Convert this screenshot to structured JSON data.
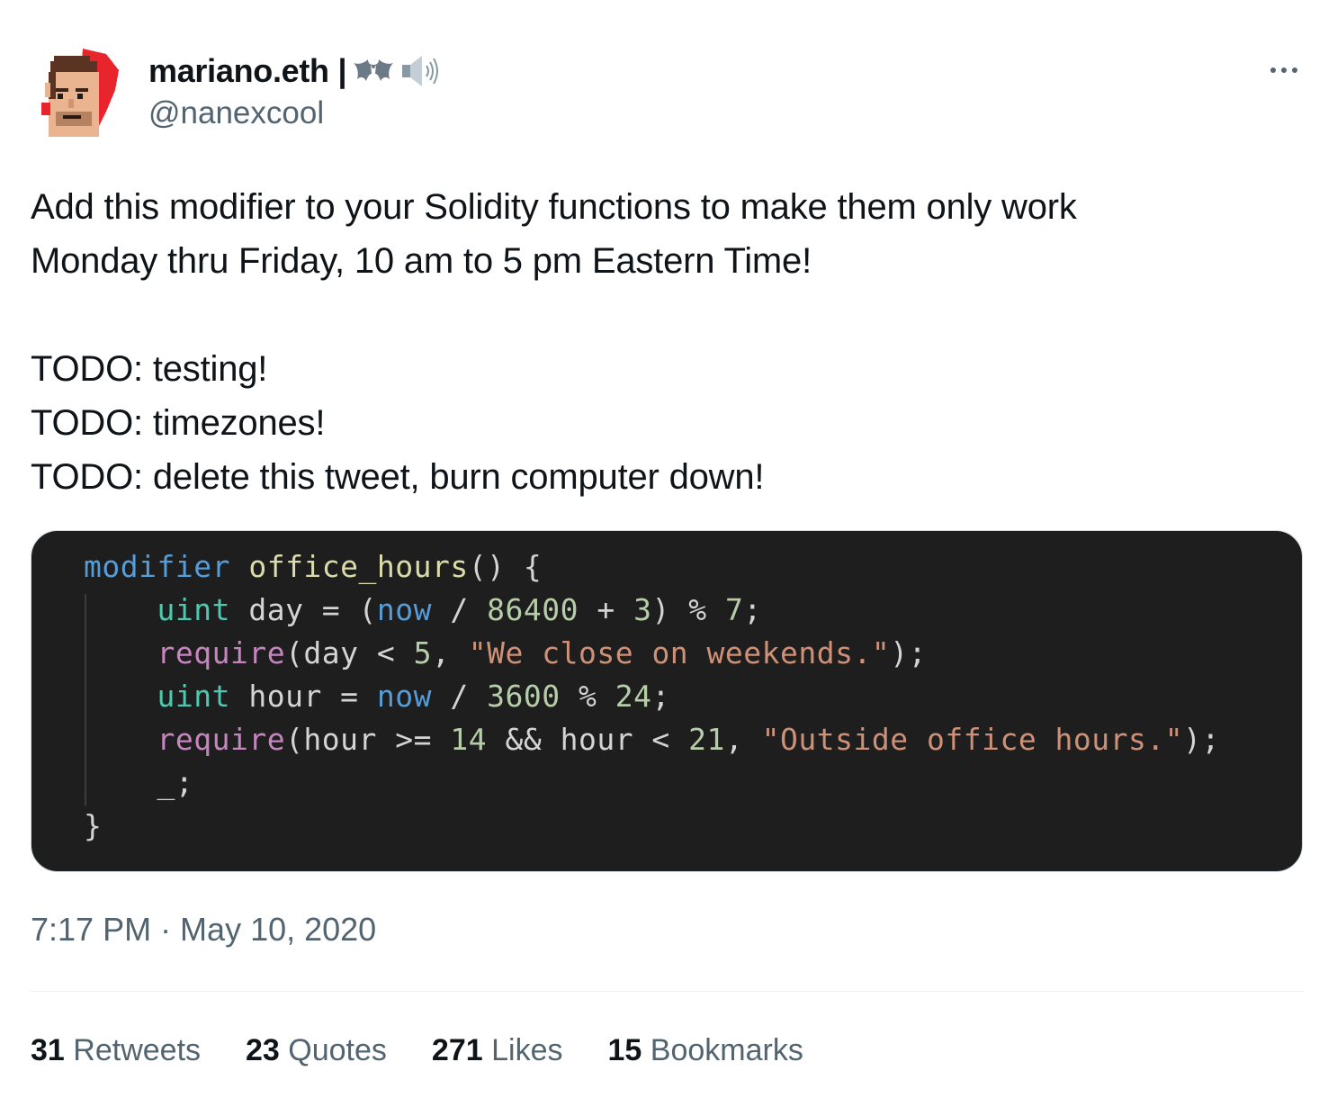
{
  "author": {
    "display_name": "mariano.eth |",
    "name_emoji": [
      "bat-icon",
      "speaker-icon"
    ],
    "handle": "@nanexcool",
    "avatar": "pixel-art-avatar"
  },
  "more_icon": "more-horizontal-icon",
  "tweet": {
    "lines": [
      "Add this modifier to your Solidity functions to make them only work",
      "Monday thru Friday, 10 am to 5 pm Eastern Time!",
      "",
      "TODO: testing!",
      "TODO: timezones!",
      "TODO: delete this tweet, burn computer down!"
    ]
  },
  "code_image": {
    "lines": [
      "modifier office_hours() {",
      "    uint day = (now / 86400 + 3) % 7;",
      "    require(day < 5, \"We close on weekends.\");",
      "    uint hour = now / 3600 % 24;",
      "    require(hour >= 14 && hour < 21, \"Outside office hours.\");",
      "    _;",
      "}"
    ],
    "colors": {
      "background": "#1e1e1e",
      "keyword": "#569cd6",
      "function": "#dcdcaa",
      "type": "#4ec9b0",
      "control": "#c586c0",
      "number": "#b5cea8",
      "string": "#ce9178",
      "text": "#d4d4d4"
    }
  },
  "meta": {
    "timestamp": "7:17 PM · May 10, 2020"
  },
  "stats": {
    "retweets": {
      "count": "31",
      "label": "Retweets"
    },
    "quotes": {
      "count": "23",
      "label": "Quotes"
    },
    "likes": {
      "count": "271",
      "label": "Likes"
    },
    "bookmarks": {
      "count": "15",
      "label": "Bookmarks"
    }
  }
}
